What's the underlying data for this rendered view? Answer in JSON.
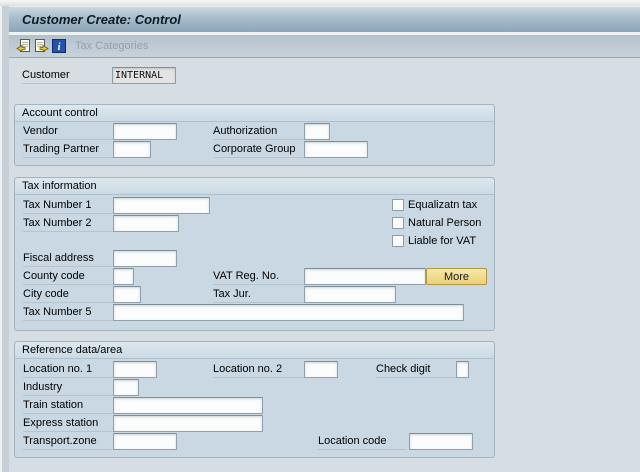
{
  "window_title": "Customer Create: Control",
  "toolbar": {
    "icons": [
      "previous-screen-icon",
      "next-screen-icon",
      "information-icon"
    ],
    "tax_categories_label": "Tax Categories"
  },
  "header_fields": {
    "customer": {
      "label": "Customer",
      "value": "INTERNAL"
    }
  },
  "sections": {
    "account_control": {
      "title": "Account control",
      "vendor_label": "Vendor",
      "vendor_value": "",
      "authorization_label": "Authorization",
      "authorization_value": "",
      "trading_partner_label": "Trading Partner",
      "trading_partner_value": "",
      "corporate_group_label": "Corporate Group",
      "corporate_group_value": ""
    },
    "tax_information": {
      "title": "Tax information",
      "tax_number_1_label": "Tax Number 1",
      "tax_number_1_value": "",
      "tax_number_2_label": "Tax Number 2",
      "tax_number_2_value": "",
      "fiscal_address_label": "Fiscal address",
      "fiscal_address_value": "",
      "county_code_label": "County code",
      "county_code_value": "",
      "vat_reg_no_label": "VAT Reg. No.",
      "vat_reg_no_value": "",
      "more_button_label": "More",
      "city_code_label": "City code",
      "city_code_value": "",
      "tax_jur_label": "Tax Jur.",
      "tax_jur_value": "",
      "tax_number_5_label": "Tax Number 5",
      "tax_number_5_value": "",
      "checkboxes": [
        {
          "label": "Equalizatn tax",
          "checked": false
        },
        {
          "label": "Natural Person",
          "checked": false
        },
        {
          "label": "Liable for VAT",
          "checked": false
        }
      ]
    },
    "reference_data": {
      "title": "Reference data/area",
      "location_no_1_label": "Location no. 1",
      "location_no_1_value": "",
      "location_no_2_label": "Location no. 2",
      "location_no_2_value": "",
      "check_digit_label": "Check digit",
      "check_digit_value": "",
      "industry_label": "Industry",
      "industry_value": "",
      "train_station_label": "Train station",
      "train_station_value": "",
      "express_station_label": "Express station",
      "express_station_value": "",
      "transport_zone_label": "Transport.zone",
      "transport_zone_value": "",
      "location_code_label": "Location code",
      "location_code_value": ""
    }
  },
  "colors": {
    "titlebar_gradient_top": "#ccd8e1",
    "titlebar_gradient_bottom": "#8da5b9",
    "main_background": "#d6dde3",
    "groupbox_background": "#c9d8e3",
    "more_button_yellow": "#ebd077",
    "readonly_field_gray": "#e4e5e3",
    "disabled_text": "#94a1ad"
  }
}
